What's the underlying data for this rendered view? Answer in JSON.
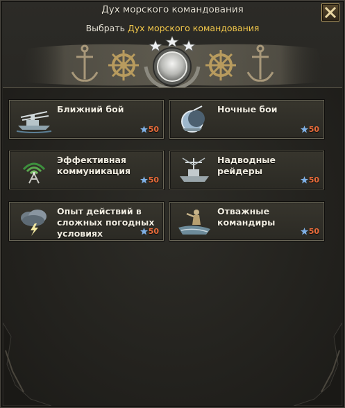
{
  "window": {
    "title": "Дух морского командования",
    "subtitle_prefix": "Выбрать",
    "subtitle_highlight": "Дух морского командования"
  },
  "colors": {
    "highlight": "#f2c84b",
    "cost_text": "#e86b3a",
    "star": "#7fb0e6",
    "card_border": "#6b6858"
  },
  "cards": [
    {
      "label": "Ближний бой",
      "cost": "50",
      "icon": "battleships-close-combat-icon"
    },
    {
      "label": "Ночные бои",
      "cost": "50",
      "icon": "night-battle-moon-icon"
    },
    {
      "label": "Эффективная коммуникация",
      "cost": "50",
      "icon": "radio-antenna-icon"
    },
    {
      "label": "Надводные рейдеры",
      "cost": "50",
      "icon": "surface-raider-ship-icon"
    },
    {
      "label": "Опыт действий в сложных погодных условиях",
      "cost": "50",
      "icon": "storm-cloud-lightning-icon"
    },
    {
      "label": "Отважные командиры",
      "cost": "50",
      "icon": "brave-commander-statue-icon"
    }
  ]
}
